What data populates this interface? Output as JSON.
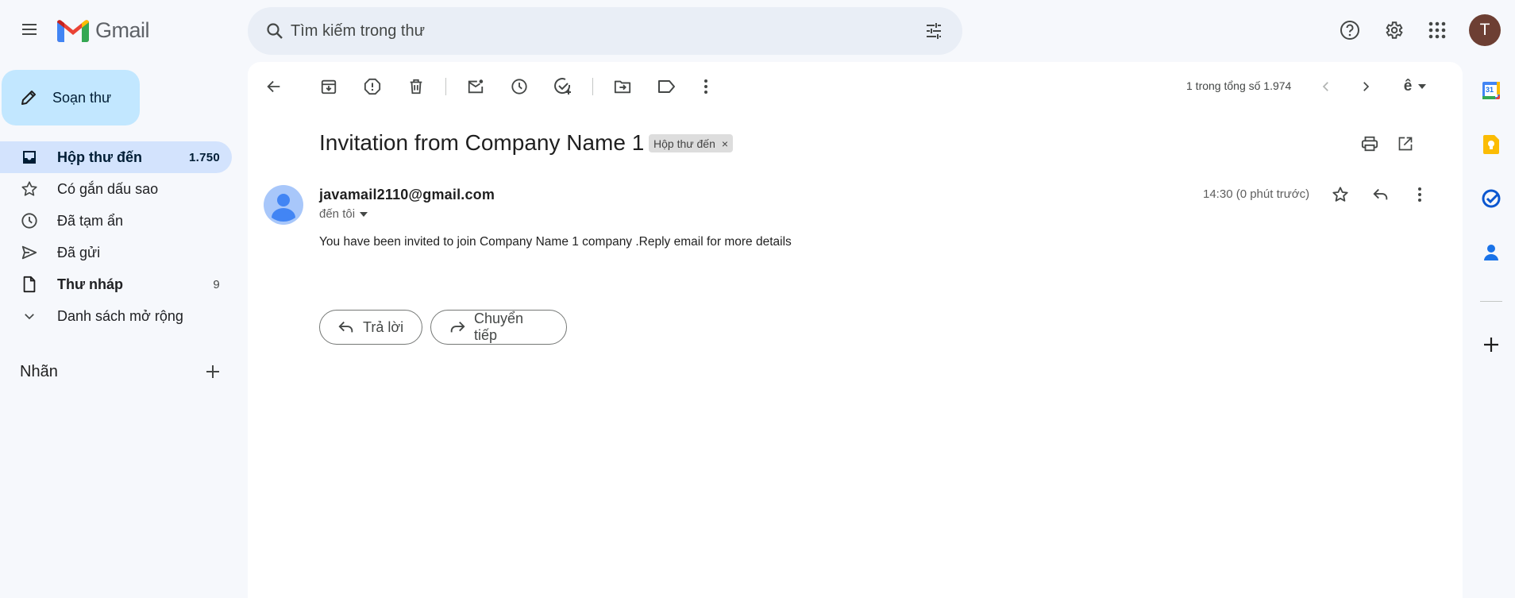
{
  "app": {
    "logo_text": "Gmail"
  },
  "search": {
    "placeholder": "Tìm kiếm trong thư"
  },
  "user": {
    "avatar_letter": "T"
  },
  "compose": {
    "label": "Soạn thư"
  },
  "nav": [
    {
      "label": "Hộp thư đến",
      "count": "1.750"
    },
    {
      "label": "Có gắn dấu sao",
      "count": ""
    },
    {
      "label": "Đã tạm ẩn",
      "count": ""
    },
    {
      "label": "Đã gửi",
      "count": ""
    },
    {
      "label": "Thư nháp",
      "count": "9"
    },
    {
      "label": "Danh sách mở rộng",
      "count": ""
    }
  ],
  "labels": {
    "title": "Nhãn"
  },
  "pager": {
    "text": "1 trong tổng số 1.974",
    "input_tool": "ê"
  },
  "email": {
    "subject": "Invitation from Company Name 1",
    "label_chip": "Hộp thư đến",
    "chip_close": "×",
    "sender": "javamail2110@gmail.com",
    "recipient": "đến tôi",
    "time": "14:30 (0 phút trước)",
    "body": "You have been invited to join Company Name 1 company .Reply email for more details"
  },
  "actions": {
    "reply": "Trả lời",
    "forward": "Chuyển tiếp"
  },
  "side_panel": {
    "calendar_day": "31"
  },
  "colors": {
    "accent_blue": "#0b57d0",
    "compose_bg": "#c2e7ff",
    "active_nav_bg": "#d3e3fd",
    "avatar_bg": "#6d3f33"
  }
}
